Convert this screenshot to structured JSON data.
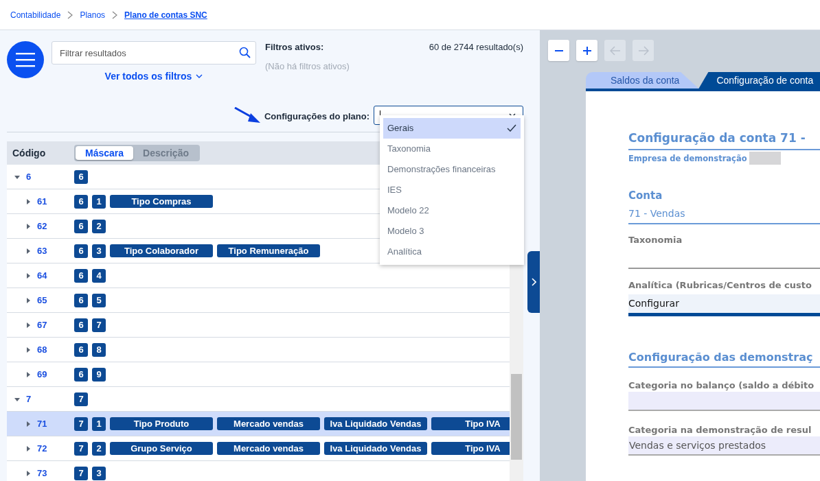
{
  "breadcrumb": [
    {
      "label": "Contabilidade",
      "current": false
    },
    {
      "label": "Planos",
      "current": false
    },
    {
      "label": "Plano de contas SNC",
      "current": true
    }
  ],
  "search": {
    "placeholder": "Filtrar resultados"
  },
  "filters_link": "Ver todos os filtros",
  "active_filters": {
    "title": "Filtros ativos:",
    "empty": "(Não há filtros ativos)"
  },
  "results": "60 de 2744 resultado(s)",
  "plan_config": {
    "label": "Configurações do plano:",
    "expanded": true,
    "options": [
      {
        "label": "Gerais",
        "selected": true
      },
      {
        "label": "Taxonomia",
        "selected": false
      },
      {
        "label": "Demonstrações financeiras",
        "selected": false
      },
      {
        "label": "IES",
        "selected": false
      },
      {
        "label": "Modelo 22",
        "selected": false
      },
      {
        "label": "Modelo 3",
        "selected": false
      },
      {
        "label": "Analítica",
        "selected": false
      }
    ]
  },
  "table": {
    "column": "Código",
    "view_toggle": [
      {
        "label": "Máscara",
        "selected": true
      },
      {
        "label": "Descrição",
        "selected": false
      }
    ],
    "rows": [
      {
        "code": "6",
        "expanded": true,
        "selected": false,
        "mask": [
          "6"
        ],
        "children": [
          {
            "code": "61",
            "expanded": false,
            "selected": false,
            "mask": [
              "6",
              "1"
            ],
            "tags": [
              "Tipo Compras"
            ]
          },
          {
            "code": "62",
            "expanded": false,
            "selected": false,
            "mask": [
              "6",
              "2"
            ]
          },
          {
            "code": "63",
            "expanded": false,
            "selected": false,
            "mask": [
              "6",
              "3"
            ],
            "tags": [
              "Tipo Colaborador",
              "Tipo Remuneração"
            ]
          },
          {
            "code": "64",
            "expanded": false,
            "selected": false,
            "mask": [
              "6",
              "4"
            ]
          },
          {
            "code": "65",
            "expanded": false,
            "selected": false,
            "mask": [
              "6",
              "5"
            ]
          },
          {
            "code": "67",
            "expanded": false,
            "selected": false,
            "mask": [
              "6",
              "7"
            ]
          },
          {
            "code": "68",
            "expanded": false,
            "selected": false,
            "mask": [
              "6",
              "8"
            ]
          },
          {
            "code": "69",
            "expanded": false,
            "selected": false,
            "mask": [
              "6",
              "9"
            ]
          }
        ]
      },
      {
        "code": "7",
        "expanded": true,
        "selected": false,
        "mask": [
          "7"
        ],
        "children": [
          {
            "code": "71",
            "expanded": false,
            "selected": true,
            "mask": [
              "7",
              "1"
            ],
            "tags": [
              "Tipo Produto",
              "Mercado vendas",
              "Iva Liquidado Vendas",
              "Tipo IVA"
            ]
          },
          {
            "code": "72",
            "expanded": false,
            "selected": false,
            "mask": [
              "7",
              "2"
            ],
            "tags": [
              "Grupo Serviço",
              "Mercado vendas",
              "Iva Liquidado Vendas",
              "Tipo IVA"
            ]
          },
          {
            "code": "73",
            "expanded": false,
            "selected": false,
            "mask": [
              "7",
              "3"
            ]
          }
        ]
      }
    ]
  },
  "zoom_toolbar": [
    {
      "kind": "zoom-out",
      "disabled": false
    },
    {
      "kind": "zoom-in",
      "disabled": false
    },
    {
      "kind": "back",
      "disabled": true
    },
    {
      "kind": "forward",
      "disabled": true
    }
  ],
  "detail": {
    "tabs": [
      {
        "label": "Saldos da conta",
        "selected": false
      },
      {
        "label": "Configuração de conta",
        "selected": true
      }
    ],
    "title": "Configuração da conta 71 -",
    "company": "Empresa de demonstração",
    "fields": [
      {
        "kind": "link",
        "label": "Conta",
        "value": "71 - Vendas"
      },
      {
        "kind": "text",
        "label": "Taxonomia"
      },
      {
        "kind": "action",
        "label": "Analítica (Rubricas/Centros de custo",
        "value": "Configurar"
      },
      {
        "kind": "section",
        "label": "Configuração das demonstraç"
      },
      {
        "kind": "select",
        "label": "Categoria no balanço (saldo a débito"
      },
      {
        "kind": "select",
        "label": "Categoria na demonstração de resul",
        "value": "Vendas e serviços prestados"
      }
    ]
  }
}
